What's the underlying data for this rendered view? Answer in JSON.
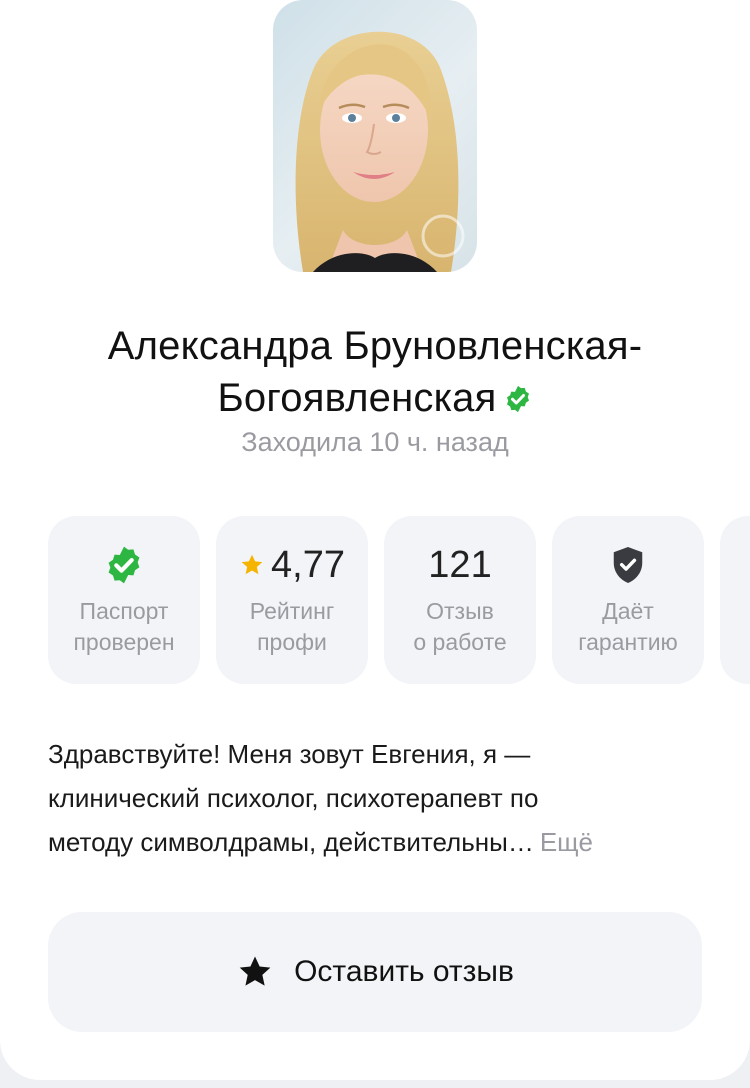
{
  "profile": {
    "name_line1": "Александра Бруновленская-",
    "name_line2": "Богоявленская",
    "last_seen": "Заходила 10 ч. назад",
    "verified_icon": "verified-badge-icon",
    "verified_color": "#2db742"
  },
  "stats": [
    {
      "icon": "check-badge-icon",
      "value": "",
      "label1": "Паспорт",
      "label2": "проверен"
    },
    {
      "icon": "star-icon",
      "value": "4,77",
      "label1": "Рейтинг",
      "label2": "профи"
    },
    {
      "icon": "",
      "value": "121",
      "label1": "Отзыв",
      "label2": "о работе"
    },
    {
      "icon": "shield-check-icon",
      "value": "",
      "label1": "Даёт",
      "label2": "гарантию"
    }
  ],
  "about": {
    "line1": "Здравствуйте! Меня зовут Евгения, я —",
    "line2": "клинический психолог, психотерапевт по",
    "line3": "методу символдрамы, действительны…",
    "more_label": "Ещё"
  },
  "actions": {
    "review_label": "Оставить отзыв"
  },
  "colors": {
    "accent_green": "#2db742",
    "star_yellow": "#f5b400",
    "muted_text": "#9a9ba1",
    "tile_bg": "#f3f4f7"
  }
}
